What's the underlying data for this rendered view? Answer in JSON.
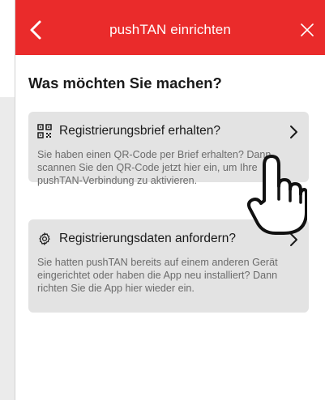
{
  "header": {
    "title": "pushTAN einrichten",
    "back_icon": "chevron-left-icon",
    "close_icon": "close-icon",
    "background_color": "#ea2b2b"
  },
  "main": {
    "heading": "Was möchten Sie machen?",
    "options": [
      {
        "icon": "qr-code-icon",
        "title": "Registrierungsbrief erhalten?",
        "description": "Sie haben einen QR-Code per Brief erhalten? Dann scannen Sie den QR-Code jetzt hier ein, um Ihre pushTAN-Verbindung zu aktivieren."
      },
      {
        "icon": "gear-icon",
        "title": "Registrierungsdaten anfordern?",
        "description": "Sie hatten pushTAN bereits auf einem anderen Gerät eingerichtet oder haben die App neu installiert? Dann richten Sie die App hier wieder ein."
      }
    ]
  },
  "overlay": {
    "icon": "hand-pointer-icon"
  }
}
